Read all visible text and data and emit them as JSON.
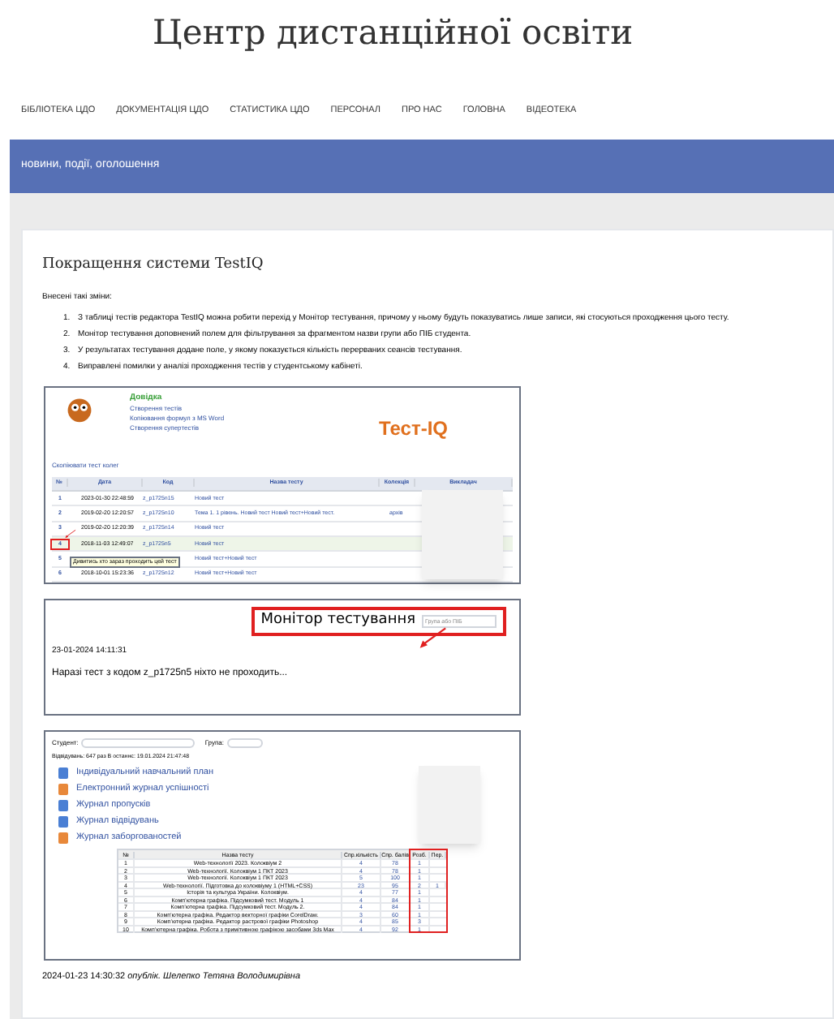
{
  "site_title": "Центр дистанційної освіти",
  "nav": [
    {
      "label": "БІБЛІОТЕКА ЦДО"
    },
    {
      "label": "ДОКУМЕНТАЦІЯ ЦДО"
    },
    {
      "label": "СТАТИСТИКА ЦДО"
    },
    {
      "label": "ПЕРСОНАЛ"
    },
    {
      "label": "ПРО НАС"
    },
    {
      "label": "ГОЛОВНА"
    },
    {
      "label": "ВІДЕОТЕКА"
    }
  ],
  "banner": "новини, події, оголошення",
  "article": {
    "title": "Покращення системи TestIQ",
    "intro": "Внесені такі зміни:",
    "changes": [
      {
        "n": "1.",
        "text": "З таблиці тестів редактора TestIQ можна робити перехід у Монітор тестування, причому у ньому будуть показуватись лише записи, які стосуються проходження цього тесту."
      },
      {
        "n": "2.",
        "text": "Монітор тестування доповнений полем для фільтрування за фрагментом назви групи або ПІБ студента."
      },
      {
        "n": "3.",
        "text": "У результатах тестування додане поле, у якому показується кількість перерваних сеансів тестування."
      },
      {
        "n": "4.",
        "text": "Виправлені помилки у аналізі проходження тестів у студентському кабінеті."
      }
    ],
    "shot_editor": {
      "help_title": "Довідка",
      "help_links": [
        "Створення тестів",
        "Копіювання формул з MS Word",
        "Створення супертестів"
      ],
      "brand": "Тест-IQ",
      "copy_link": "Скопіювати тест колег",
      "columns": [
        "№",
        "Дата",
        "Код",
        "Назва тесту",
        "Колекція",
        "Викладач"
      ],
      "rows": [
        {
          "n": "1",
          "date": "2023-01-30 22:48:59",
          "code": "z_p1725n15",
          "name": "Новий тест",
          "collection": "",
          "highlighted": false
        },
        {
          "n": "2",
          "date": "2019-02-20 12:20:57",
          "code": "z_p1725n10",
          "name": "Тема 1. 1 рівень. Новий тест Новий тест+Новий тест.",
          "collection": "архів",
          "highlighted": false
        },
        {
          "n": "3",
          "date": "2019-02-20 12:20:39",
          "code": "z_p1725n14",
          "name": "Новий тест",
          "collection": "",
          "highlighted": false
        },
        {
          "n": "4",
          "date": "2018-11-03 12:49:07",
          "code": "z_p1725n5",
          "name": "Новий тест",
          "collection": "",
          "highlighted": true
        },
        {
          "n": "5",
          "date": "",
          "code": "",
          "name": "Новий тест+Новий тест",
          "collection": "",
          "highlighted": false
        },
        {
          "n": "6",
          "date": "2018-10-01 15:23:36",
          "code": "z_p1725n12",
          "name": "Новий тест+Новий тест",
          "collection": "",
          "highlighted": false
        }
      ],
      "tooltip": "Дивитись хто зараз проходить цей тест"
    },
    "shot_monitor": {
      "title": "Монітор тестування",
      "placeholder": "Група або ПІБ",
      "timestamp": "23-01-2024 14:11:31",
      "message": "Наразі тест з кодом z_p1725n5 ніхто не проходить..."
    },
    "shot_cabinet": {
      "student_label": "Студент:",
      "group_label": "Група:",
      "visits": "Відвідувань: 647 раз В останнє: 19.01.2024 21:47:48",
      "links": [
        {
          "label": "Індивідуальний навчальний план",
          "color": "#4a7fd4"
        },
        {
          "label": "Електронний журнал успішності",
          "color": "#e8883a"
        },
        {
          "label": "Журнал пропусків",
          "color": "#4a7fd4"
        },
        {
          "label": "Журнал відвідувань",
          "color": "#4a7fd4"
        },
        {
          "label": "Журнал заборгованостей",
          "color": "#e8883a"
        }
      ],
      "columns": [
        "№",
        "Назва тесту",
        "Спр.кількість",
        "Спр. балів",
        "Розб.",
        "Пер."
      ],
      "rows": [
        [
          "1",
          "Web-технології 2023. Колоквіум 2",
          "4",
          "78",
          "1",
          ""
        ],
        [
          "2",
          "Web-технології. Колоквіум 1 ПКТ 2023",
          "4",
          "78",
          "1",
          ""
        ],
        [
          "3",
          "Web-технології. Колоквіум 1 ПКТ 2023",
          "5",
          "100",
          "1",
          ""
        ],
        [
          "4",
          "Web-технології. Підготовка до колоквіуму 1 (HTML+CSS)",
          "23",
          "95",
          "2",
          "1"
        ],
        [
          "5",
          "Історія та культура України. Колоквіум.",
          "4",
          "77",
          "1",
          ""
        ],
        [
          "6",
          "Комп’ютерна графіка. Підсумковий тест. Модуль 1",
          "4",
          "84",
          "1",
          ""
        ],
        [
          "7",
          "Комп’ютерна графіка. Підсумковий тест. Модуль 2.",
          "4",
          "84",
          "1",
          ""
        ],
        [
          "8",
          "Комп’ютерна графіка. Редактор векторної графіки CorelDraw.",
          "3",
          "60",
          "1",
          ""
        ],
        [
          "9",
          "Комп’ютерна графіка. Редактор растрової графіки Photoshop",
          "4",
          "85",
          "3",
          ""
        ],
        [
          "10",
          "Комп’ютерна графіка. Робота з примітивною графікою засобами 3ds Max",
          "4",
          "92",
          "1",
          ""
        ]
      ]
    },
    "footer": {
      "date": "2024-01-23 14:30:32",
      "published": "опублік.",
      "author": "Шелепко Тетяна Володимирівна"
    }
  }
}
